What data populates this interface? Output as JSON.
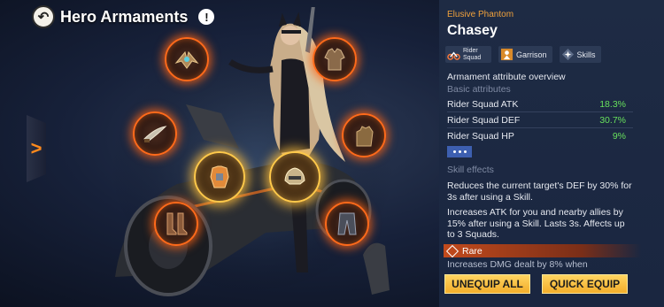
{
  "header": {
    "title": "Hero Armaments",
    "back_icon": "back-arrow-icon",
    "info_symbol": "!"
  },
  "nav": {
    "prev_symbol": ">"
  },
  "hero": {
    "faction": "Elusive Phantom",
    "name": "Chasey",
    "tags": [
      {
        "label": "Rider Squad",
        "icon": "motorcycle-icon"
      },
      {
        "label": "Garrison",
        "icon": "garrison-icon"
      },
      {
        "label": "Skills",
        "icon": "skills-icon"
      }
    ]
  },
  "slots": [
    {
      "name": "wings-armament",
      "icon": "wings-icon"
    },
    {
      "name": "jacket-armament",
      "icon": "jacket-icon"
    },
    {
      "name": "dagger-armament",
      "icon": "dagger-icon"
    },
    {
      "name": "gloves-armament",
      "icon": "gloves-icon"
    },
    {
      "name": "chest-armor-armament",
      "icon": "chest-armor-icon"
    },
    {
      "name": "helmet-armament",
      "icon": "helmet-icon"
    },
    {
      "name": "boots-armament",
      "icon": "boots-icon"
    },
    {
      "name": "pants-armament",
      "icon": "pants-icon"
    }
  ],
  "attributes": {
    "title": "Armament attribute overview",
    "basic_label": "Basic attributes",
    "stats": [
      {
        "label": "Rider Squad ATK",
        "value": "18.3%"
      },
      {
        "label": "Rider Squad DEF",
        "value": "30.7%"
      },
      {
        "label": "Rider Squad HP",
        "value": "9%"
      }
    ]
  },
  "skill_effects": {
    "label": "Skill effects",
    "effects": [
      "Reduces the current target's DEF by 30% for 3s after using a Skill.",
      "Increases ATK for you and nearby allies by 15% after using a Skill. Lasts 3s. Affects up to 3 Squads."
    ],
    "rarity": "Rare",
    "rare_effect": "Increases DMG dealt by 8% when"
  },
  "buttons": {
    "unequip_all": "UNEQUIP ALL",
    "quick_equip": "QUICK EQUIP"
  },
  "colors": {
    "accent": "#ff8a1c",
    "positive": "#67e05c",
    "button": "#f3ae2b",
    "panel": "#1e2b44"
  }
}
